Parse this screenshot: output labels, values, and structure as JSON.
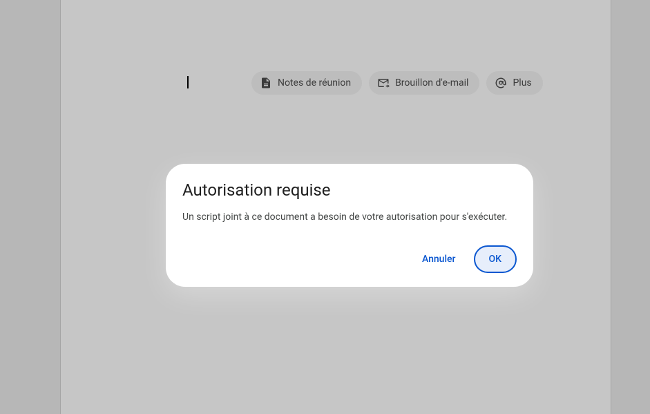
{
  "chips": {
    "meetingNotes": {
      "label": "Notes de réunion"
    },
    "emailDraft": {
      "label": "Brouillon d'e-mail"
    },
    "more": {
      "label": "Plus"
    }
  },
  "dialog": {
    "title": "Autorisation requise",
    "body": "Un script joint à ce document a besoin de votre autorisation pour s'exécuter.",
    "cancel": "Annuler",
    "confirm": "OK"
  }
}
